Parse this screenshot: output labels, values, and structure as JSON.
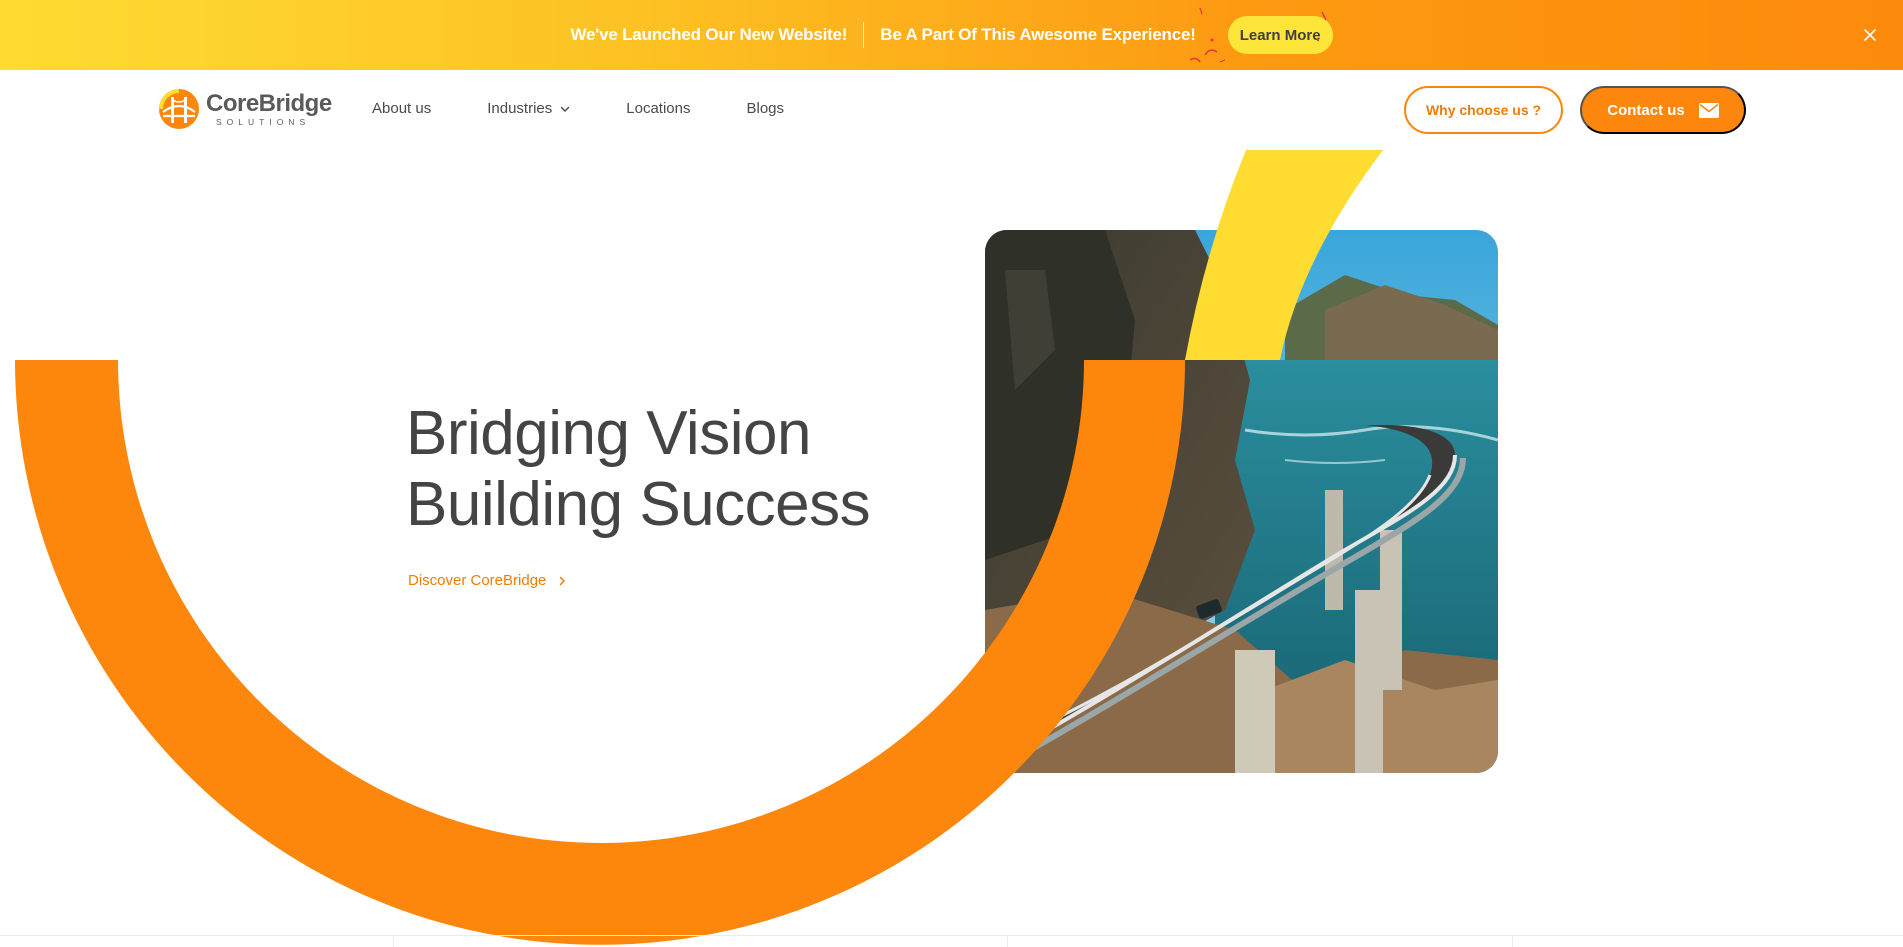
{
  "announcement": {
    "message_1": "We've Launched Our New Website!",
    "message_2": "Be A Part Of This Awesome Experience!",
    "learn_more_label": "Learn More",
    "close_icon": "close-icon"
  },
  "brand": {
    "name": "CoreBridge",
    "tagline": "SOLUTIONS",
    "icon": "bridge-logo-icon"
  },
  "nav": {
    "items": [
      {
        "label": "About us"
      },
      {
        "label": "Industries",
        "icon": "chevron-down-icon"
      },
      {
        "label": "Locations"
      },
      {
        "label": "Blogs"
      }
    ],
    "why_label": "Why choose us ?",
    "contact_label": "Contact us",
    "contact_icon": "mail-icon"
  },
  "hero": {
    "title_line_1": "Bridging Vision",
    "title_line_2": "Building Success",
    "cta_label": "Discover CoreBridge",
    "cta_icon": "chevron-right-icon",
    "image": "coastal-bridge-photo"
  },
  "colors": {
    "accent_orange": "#fd870c",
    "accent_yellow": "#fedc32",
    "text_dark": "#444444"
  }
}
